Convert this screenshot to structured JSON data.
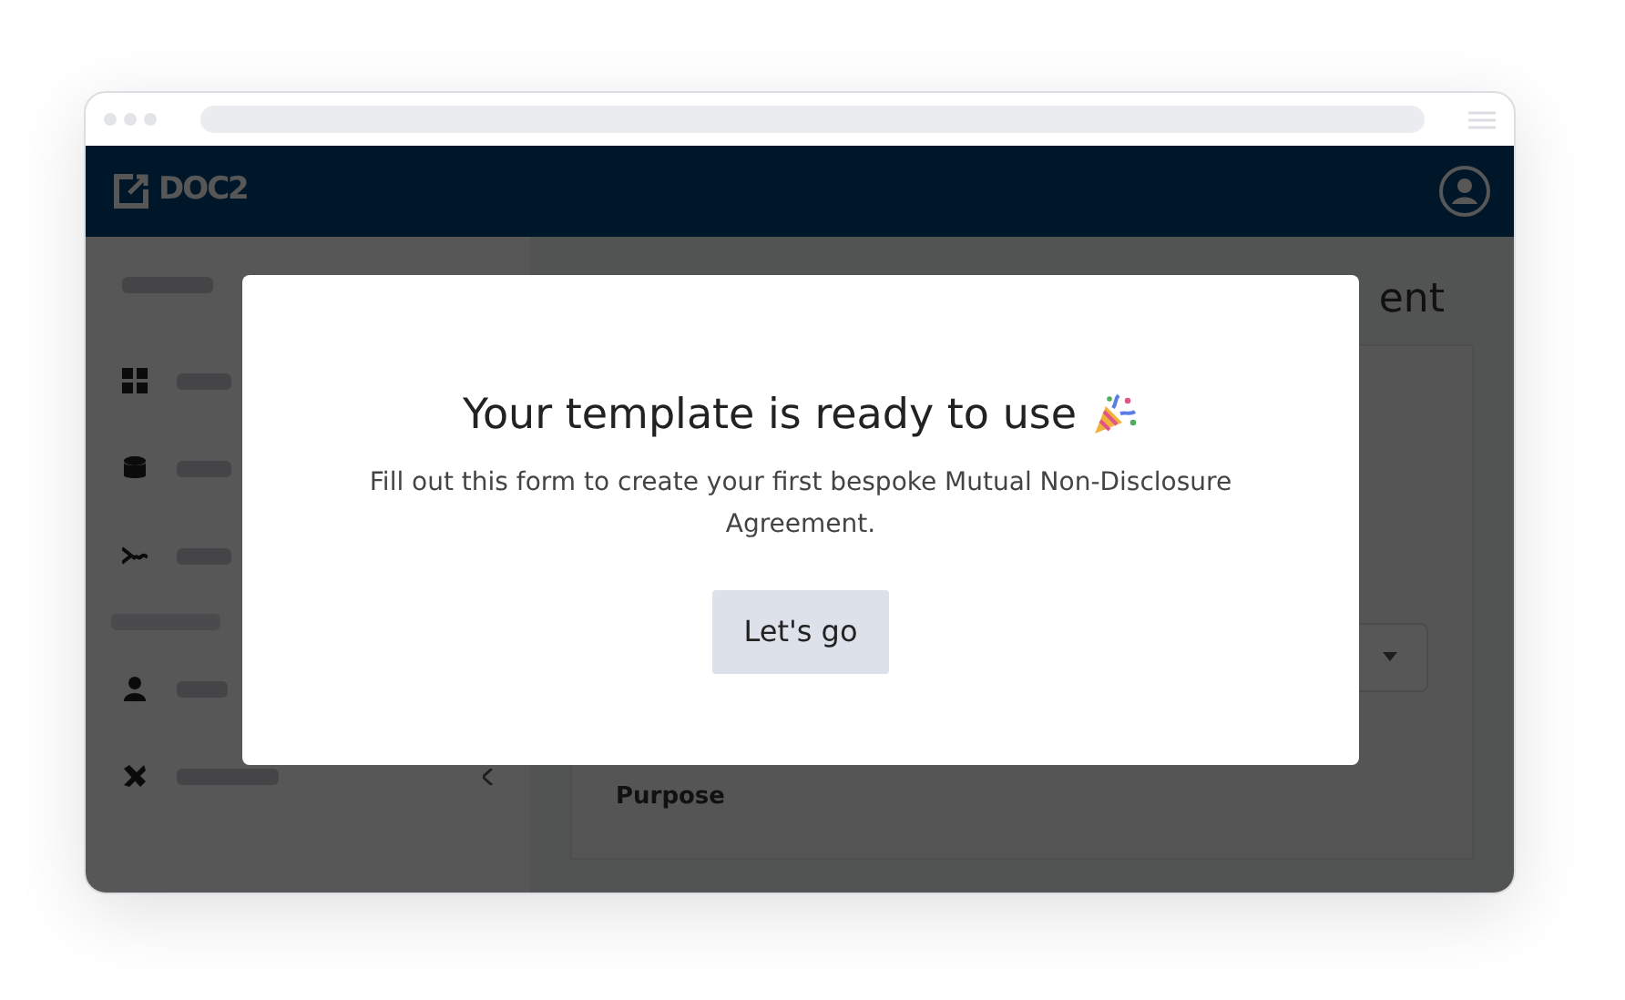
{
  "header": {
    "logo_text": "DOC2"
  },
  "main": {
    "title": "ent",
    "section_label": "Purpose"
  },
  "modal": {
    "title": "Your template is ready to use",
    "text": "Fill out this form to create your first bespoke Mutual Non-Disclosure Agreement.",
    "button": "Let's go"
  }
}
